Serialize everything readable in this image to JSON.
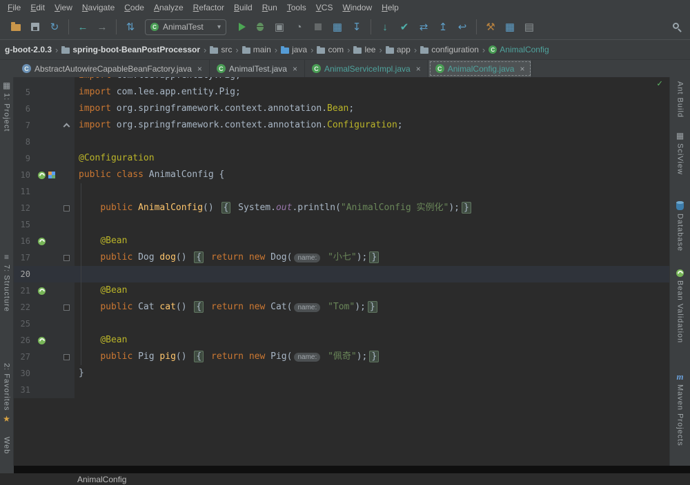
{
  "menu": {
    "items": [
      {
        "label": "File"
      },
      {
        "label": "Edit"
      },
      {
        "label": "View"
      },
      {
        "label": "Navigate"
      },
      {
        "label": "Code"
      },
      {
        "label": "Analyze"
      },
      {
        "label": "Refactor"
      },
      {
        "label": "Build"
      },
      {
        "label": "Run"
      },
      {
        "label": "Tools"
      },
      {
        "label": "VCS"
      },
      {
        "label": "Window"
      },
      {
        "label": "Help"
      }
    ]
  },
  "toolbar": {
    "run_config": {
      "label": "AnimalTest",
      "icon_letter": "C",
      "icon_color": "#499C54"
    },
    "items": [
      {
        "type": "icon",
        "name": "open-project-icon",
        "shape": "folder",
        "color": "#c9964a"
      },
      {
        "type": "icon",
        "name": "save-all-icon",
        "shape": "floppy",
        "color": "#9aa5ac"
      },
      {
        "type": "icon",
        "name": "synchronize-icon",
        "glyph": "↻",
        "color": "#5e9ec7"
      },
      {
        "type": "sep"
      },
      {
        "type": "icon",
        "name": "back-icon",
        "glyph": "←",
        "color": "#4fb0aa"
      },
      {
        "type": "icon",
        "name": "forward-icon",
        "glyph": "→",
        "color": "#7d8486"
      },
      {
        "type": "sep"
      },
      {
        "type": "icon",
        "name": "annotate-icon",
        "glyph": "⇅",
        "color": "#5e9ec7"
      },
      {
        "type": "combo"
      },
      {
        "type": "icon",
        "name": "run-icon",
        "shape": "run",
        "color": "#4CA654"
      },
      {
        "type": "icon",
        "name": "debug-icon",
        "shape": "bug",
        "color": "#5f8f5f"
      },
      {
        "type": "icon",
        "name": "coverage-icon",
        "glyph": "▣",
        "color": "#8b9294"
      },
      {
        "type": "icon",
        "name": "profiler-icon",
        "glyph": "◔",
        "color": "#8b9294"
      },
      {
        "type": "icon",
        "name": "stop-icon",
        "shape": "stop",
        "color": "#646869"
      },
      {
        "type": "icon",
        "name": "restore-layout-icon",
        "glyph": "▦",
        "color": "#5e9ec7"
      },
      {
        "type": "icon",
        "name": "sync-settings-icon",
        "glyph": "↧",
        "color": "#5e9ec7"
      },
      {
        "type": "sep"
      },
      {
        "type": "icon",
        "name": "vcs-update-icon",
        "glyph": "↓",
        "color": "#4fb0aa"
      },
      {
        "type": "icon",
        "name": "vcs-commit-icon",
        "glyph": "✔",
        "color": "#4fb0aa"
      },
      {
        "type": "icon",
        "name": "vcs-compare-icon",
        "glyph": "⇄",
        "color": "#5e9ec7"
      },
      {
        "type": "icon",
        "name": "vcs-push-icon",
        "glyph": "↥",
        "color": "#5e9ec7"
      },
      {
        "type": "icon",
        "name": "vcs-rollback-icon",
        "glyph": "↩",
        "color": "#5e9ec7"
      },
      {
        "type": "sep"
      },
      {
        "type": "icon",
        "name": "tools-icon",
        "glyph": "⚒",
        "color": "#b5803f"
      },
      {
        "type": "icon",
        "name": "project-structure-icon",
        "glyph": "▦",
        "color": "#5e9ec7"
      },
      {
        "type": "icon",
        "name": "module-settings-icon",
        "glyph": "▤",
        "color": "#8b9294"
      }
    ]
  },
  "breadcrumbs": {
    "separator": "›",
    "items": [
      {
        "label": "g-boot-2.0.3",
        "icon": "none",
        "bold": true
      },
      {
        "label": "spring-boot-BeanPostProcessor",
        "icon": "folder",
        "bold": true
      },
      {
        "label": "src",
        "icon": "folder"
      },
      {
        "label": "main",
        "icon": "folder"
      },
      {
        "label": "java",
        "icon": "folder",
        "icon_color": "#559CD6"
      },
      {
        "label": "com",
        "icon": "folder"
      },
      {
        "label": "lee",
        "icon": "folder"
      },
      {
        "label": "app",
        "icon": "folder"
      },
      {
        "label": "configuration",
        "icon": "folder"
      },
      {
        "label": "AnimalConfig",
        "icon": "class",
        "icon_letter": "C",
        "icon_color": "#499C54",
        "color": "#4fa39d"
      }
    ]
  },
  "tabs": [
    {
      "label": "AbstractAutowireCapableBeanFactory.java",
      "close": "×",
      "icon_letter": "C",
      "icon_color": "#6a8fb3",
      "text_color": "#bbbbbb",
      "selected": false
    },
    {
      "label": "AnimalTest.java",
      "close": "×",
      "icon_letter": "C",
      "icon_color": "#499C54",
      "text_color": "#b9bec0",
      "selected": false
    },
    {
      "label": "AnimalServiceImpl.java",
      "close": "×",
      "icon_letter": "C",
      "icon_color": "#499C54",
      "text_color": "#4fa39d",
      "selected": false
    },
    {
      "label": "AnimalConfig.java",
      "close": "×",
      "icon_letter": "C",
      "icon_color": "#499C54",
      "text_color": "#4fa39d",
      "selected": true
    }
  ],
  "left_strip": [
    {
      "label": "1: Project",
      "icon": "window"
    },
    {
      "label": "7: Structure",
      "icon": "lines"
    },
    {
      "label": "2: Favorites",
      "icon": "star",
      "icon_after": true
    },
    {
      "label": "Web",
      "icon": "none"
    }
  ],
  "right_strip": [
    {
      "label": "Ant Build",
      "icon": "none"
    },
    {
      "label": "SciView",
      "icon": "grid"
    },
    {
      "label": "Database",
      "icon": "db"
    },
    {
      "label": "Bean Validation",
      "icon": "bean"
    },
    {
      "label": "Maven Projects",
      "icon": "maven",
      "icon_letter": "m"
    }
  ],
  "editor": {
    "inspection_status": "✓",
    "caret_line": "20",
    "lines": [
      {
        "n": "",
        "partial": true,
        "tokens": [
          [
            "kw",
            "import"
          ],
          [
            "pl",
            " com.lee.app.entity.Pig;"
          ]
        ]
      },
      {
        "n": "5",
        "tokens": [
          [
            "kw",
            "import"
          ],
          [
            "pl",
            " com.lee.app.entity.Pig;"
          ]
        ]
      },
      {
        "n": "6",
        "tokens": [
          [
            "kw",
            "import"
          ],
          [
            "pl",
            " org.springframework.context.annotation."
          ],
          [
            "ann",
            "Bean"
          ],
          [
            "pl",
            ";"
          ]
        ]
      },
      {
        "n": "7",
        "fold": "up",
        "tokens": [
          [
            "kw",
            "import"
          ],
          [
            "pl",
            " org.springframework.context.annotation."
          ],
          [
            "ann",
            "Configuration"
          ],
          [
            "pl",
            ";"
          ]
        ]
      },
      {
        "n": "8",
        "tokens": []
      },
      {
        "n": "9",
        "tokens": [
          [
            "ann",
            "@Configuration"
          ]
        ]
      },
      {
        "n": "10",
        "gutter": [
          "bean",
          "related"
        ],
        "tokens": [
          [
            "kw",
            "public class"
          ],
          [
            "pl",
            " AnimalConfig {"
          ]
        ]
      },
      {
        "n": "11",
        "tokens": []
      },
      {
        "n": "12",
        "fold": "box",
        "tokens": [
          [
            "pl",
            "    "
          ],
          [
            "kw",
            "public"
          ],
          [
            "meth",
            " AnimalConfig"
          ],
          [
            "pl",
            "() "
          ],
          [
            "fold",
            "{"
          ],
          [
            "pl",
            " System."
          ],
          [
            "ital",
            "out"
          ],
          [
            "pl",
            ".println("
          ],
          [
            "str",
            "\"AnimalConfig 实例化\""
          ],
          [
            "pl",
            ");"
          ],
          [
            "fold",
            "}"
          ]
        ]
      },
      {
        "n": "15",
        "tokens": []
      },
      {
        "n": "16",
        "gutter": [
          "bean"
        ],
        "tokens": [
          [
            "pl",
            "    "
          ],
          [
            "ann",
            "@Bean"
          ]
        ]
      },
      {
        "n": "17",
        "fold": "box",
        "tokens": [
          [
            "pl",
            "    "
          ],
          [
            "kw",
            "public"
          ],
          [
            "pl",
            " Dog "
          ],
          [
            "meth",
            "dog"
          ],
          [
            "pl",
            "() "
          ],
          [
            "fold",
            "{"
          ],
          [
            "kw",
            " return new"
          ],
          [
            "pl",
            " Dog("
          ],
          [
            "hint",
            "name:"
          ],
          [
            "pl",
            " "
          ],
          [
            "str",
            "\"小七\""
          ],
          [
            "pl",
            ");"
          ],
          [
            "fold",
            "}"
          ]
        ]
      },
      {
        "n": "20",
        "caret": true,
        "tokens": []
      },
      {
        "n": "21",
        "gutter": [
          "bean"
        ],
        "tokens": [
          [
            "pl",
            "    "
          ],
          [
            "ann",
            "@Bean"
          ]
        ]
      },
      {
        "n": "22",
        "fold": "box",
        "tokens": [
          [
            "pl",
            "    "
          ],
          [
            "kw",
            "public"
          ],
          [
            "pl",
            " Cat "
          ],
          [
            "meth",
            "cat"
          ],
          [
            "pl",
            "() "
          ],
          [
            "fold",
            "{"
          ],
          [
            "kw",
            " return new"
          ],
          [
            "pl",
            " Cat("
          ],
          [
            "hint",
            "name:"
          ],
          [
            "pl",
            " "
          ],
          [
            "str",
            "\"Tom\""
          ],
          [
            "pl",
            ");"
          ],
          [
            "fold",
            "}"
          ]
        ]
      },
      {
        "n": "25",
        "tokens": []
      },
      {
        "n": "26",
        "gutter": [
          "bean"
        ],
        "tokens": [
          [
            "pl",
            "    "
          ],
          [
            "ann",
            "@Bean"
          ]
        ]
      },
      {
        "n": "27",
        "fold": "box",
        "tokens": [
          [
            "pl",
            "    "
          ],
          [
            "kw",
            "public"
          ],
          [
            "pl",
            " Pig "
          ],
          [
            "meth",
            "pig"
          ],
          [
            "pl",
            "() "
          ],
          [
            "fold",
            "{"
          ],
          [
            "kw",
            " return new"
          ],
          [
            "pl",
            " Pig("
          ],
          [
            "hint",
            "name:"
          ],
          [
            "pl",
            " "
          ],
          [
            "str",
            "\"佩奇\""
          ],
          [
            "pl",
            ");"
          ],
          [
            "fold",
            "}"
          ]
        ]
      },
      {
        "n": "30",
        "tokens": [
          [
            "pl",
            "}"
          ]
        ]
      },
      {
        "n": "31",
        "tokens": []
      }
    ]
  },
  "status_bar": {
    "breadcrumb": "AnimalConfig"
  }
}
